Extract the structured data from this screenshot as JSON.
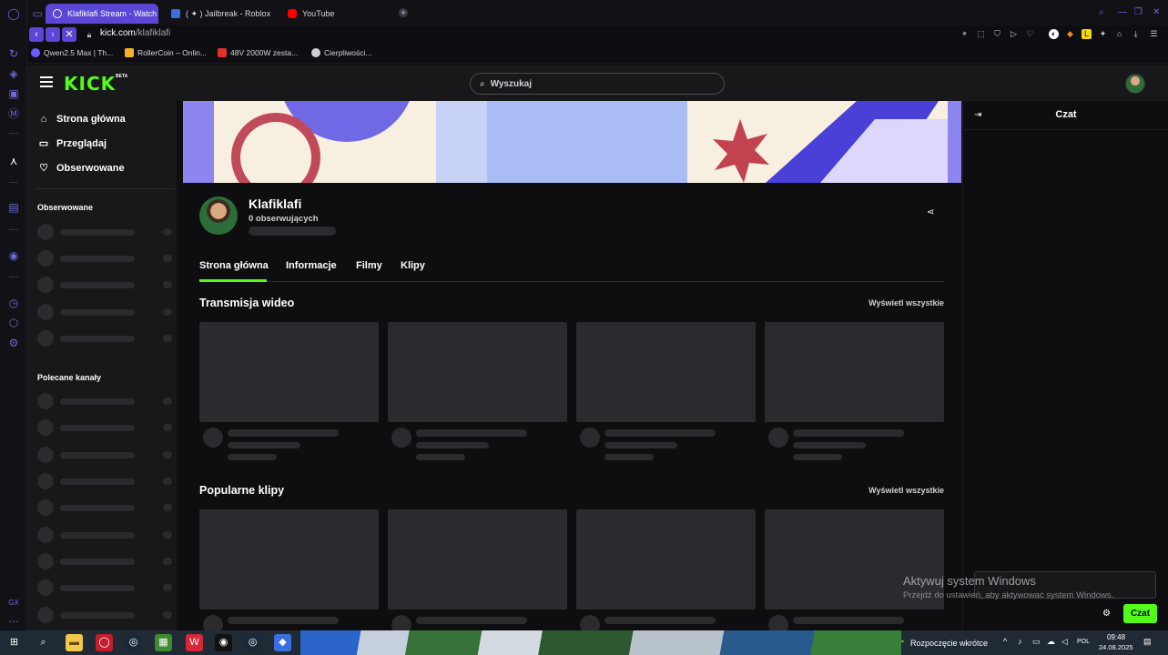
{
  "browser": {
    "tabs": [
      {
        "label": "Klafiklafi Stream - Watch",
        "active": true,
        "favicon_color": "#5a47d6"
      },
      {
        "label": "( ✦ ) Jailbreak - Roblox",
        "active": false,
        "favicon_color": "#3b6fe0"
      },
      {
        "label": "YouTube",
        "active": false,
        "favicon_color": "#ff0000"
      }
    ],
    "new_tab_symbol": "+",
    "url_host": "kick.com",
    "url_path": "/klafiklafi",
    "bookmarks": [
      {
        "label": "Qwen2.5 Max | Th...",
        "icon_color": "#6f5cff"
      },
      {
        "label": "RollerCoin – Onlin...",
        "icon_color": "#f2b32c"
      },
      {
        "label": "48V 2000W zesta...",
        "icon_color": "#e0302a"
      },
      {
        "label": "Cierpliwości...",
        "icon_color": "#cfcfcf"
      }
    ]
  },
  "kick": {
    "brand_color": "#53fc18",
    "logo_text": "KICK",
    "beta_text": "BETA",
    "search_placeholder": "Wyszukaj",
    "nav": [
      {
        "label": "Strona główna",
        "icon": "home-icon",
        "glyph": "⌂"
      },
      {
        "label": "Przeglądaj",
        "icon": "browse-icon",
        "glyph": "▭"
      },
      {
        "label": "Obserwowane",
        "icon": "heart-icon",
        "glyph": "♡"
      }
    ],
    "following_heading": "Obserwowane",
    "recommended_heading": "Polecane kanały",
    "channel": {
      "name": "Klafiklafi",
      "followers": "0 obserwujących"
    },
    "channel_tabs": [
      "Strona główna",
      "Informacje",
      "Filmy",
      "Klipy"
    ],
    "sections": [
      {
        "title": "Transmisja wideo",
        "view_all": "Wyświetl wszystkie"
      },
      {
        "title": "Popularne klipy",
        "view_all": "Wyświetl wszystkie"
      }
    ],
    "chat": {
      "title": "Czat",
      "send_label": "Czat"
    }
  },
  "windows_activation": {
    "line1": "Aktywuj system Windows",
    "line2": "Przejdź do ustawień, aby aktywować system Windows."
  },
  "taskbar": {
    "notification": "Rozpoczęcie wkrótce",
    "language": "POL",
    "time": "09:48",
    "date": "24.08.2025"
  }
}
